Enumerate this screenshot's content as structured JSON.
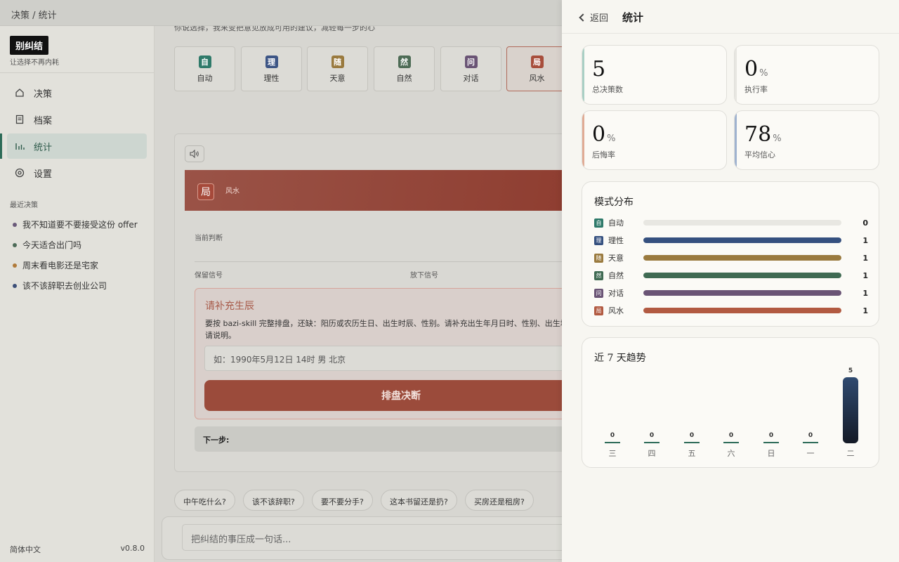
{
  "topbar": {
    "breadcrumb": "决策 / 统计"
  },
  "sidebar": {
    "brand": "别纠结",
    "tagline": "让选择不再内耗",
    "nav": [
      {
        "label": "决策",
        "icon": "home-icon",
        "active": false
      },
      {
        "label": "档案",
        "icon": "file-icon",
        "active": false
      },
      {
        "label": "统计",
        "icon": "bar-chart-icon",
        "active": true
      },
      {
        "label": "设置",
        "icon": "gear-icon",
        "active": false
      }
    ],
    "recent_title": "最近决策",
    "recent": [
      {
        "label": "我不知道要不要接受这份 offer",
        "color": "#6a5a7a"
      },
      {
        "label": "今天适合出门吗",
        "color": "#4d6b58"
      },
      {
        "label": "周末看电影还是宅家",
        "color": "#b07a3a"
      },
      {
        "label": "该不该辞职去创业公司",
        "color": "#3c4f78"
      }
    ],
    "language": "简体中文",
    "version": "v0.8.0"
  },
  "main": {
    "intro": "你说选择，我来变把意见放成可用的建议，减轻每一步的心",
    "modes": [
      {
        "glyph": "自",
        "label": "自动",
        "color": "#2f7a6a"
      },
      {
        "glyph": "理",
        "label": "理性",
        "color": "#3d5585"
      },
      {
        "glyph": "随",
        "label": "天意",
        "color": "#9a7a3e"
      },
      {
        "glyph": "然",
        "label": "自然",
        "color": "#4d6b55"
      },
      {
        "glyph": "问",
        "label": "对话",
        "color": "#6a5475"
      },
      {
        "glyph": "局",
        "label": "风水",
        "color": "#a84e3c"
      }
    ],
    "banner_glyph": "局",
    "banner_label": "风水",
    "current_judgment": "当前判断",
    "keep_signal": "保留信号",
    "drop_signal": "放下信号",
    "prompt": {
      "title": "请补充生辰",
      "desc": "要按 bazi-skill 完整排盘，还缺：阳历或农历生日、出生时辰、性别。请补充出生年月日时、性别、出生地，也请说明。",
      "placeholder": "如：1990年5月12日 14时 男 北京",
      "button": "排盘决断"
    },
    "next_step": "下一步:",
    "chips": [
      "中午吃什么?",
      "该不该辞职?",
      "要不要分手?",
      "这本书留还是扔?",
      "买房还是租房?"
    ],
    "composer_placeholder": "把纠结的事压成一句话..."
  },
  "panel": {
    "back": "返回",
    "title": "统计",
    "stats": [
      {
        "value": "5",
        "unit": "",
        "label": "总决策数",
        "accent": "#a9cfc4"
      },
      {
        "value": "0",
        "unit": "%",
        "label": "执行率",
        "accent": "#e7e6e1"
      },
      {
        "value": "0",
        "unit": "%",
        "label": "后悔率",
        "accent": "#e0ab95"
      },
      {
        "value": "78",
        "unit": "%",
        "label": "平均信心",
        "accent": "#9fb2cf"
      }
    ],
    "mode_dist_title": "模式分布",
    "trend_title": "近 7 天趋势"
  },
  "chart_data": [
    {
      "type": "bar",
      "title": "模式分布",
      "categories": [
        "自动",
        "理性",
        "天意",
        "自然",
        "对话",
        "风水"
      ],
      "glyphs": [
        "自",
        "理",
        "随",
        "然",
        "问",
        "局"
      ],
      "values": [
        0,
        1,
        1,
        1,
        1,
        1
      ],
      "max": 1,
      "colors": [
        "#2f7a6a",
        "#35507f",
        "#9a7a3e",
        "#3f6a52",
        "#6a5475",
        "#b25a41"
      ]
    },
    {
      "type": "bar",
      "title": "近 7 天趋势",
      "categories": [
        "三",
        "四",
        "五",
        "六",
        "日",
        "一",
        "二"
      ],
      "values": [
        0,
        0,
        0,
        0,
        0,
        0,
        5
      ],
      "ylim": [
        0,
        5
      ]
    }
  ]
}
